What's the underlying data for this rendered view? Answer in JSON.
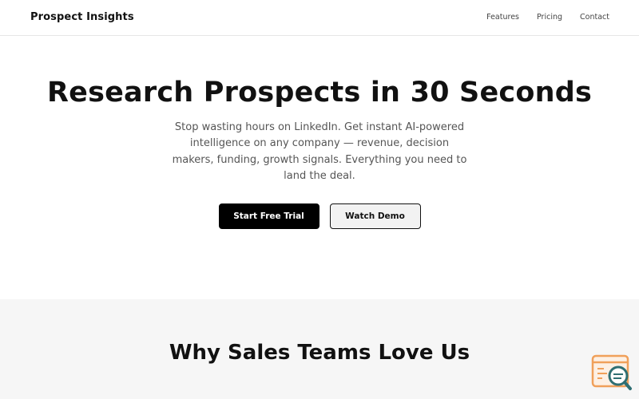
{
  "header": {
    "brand": "Prospect Insights",
    "nav": [
      "Features",
      "Pricing",
      "Contact"
    ]
  },
  "hero": {
    "title": "Research Prospects in 30 Seconds",
    "subtitle": "Stop wasting hours on LinkedIn. Get instant AI-powered intelligence on any company — revenue, decision makers, funding, growth signals. Everything you need to land the deal.",
    "primary_cta": "Start Free Trial",
    "secondary_cta": "Watch Demo"
  },
  "features": {
    "title": "Why Sales Teams Love Us"
  },
  "widget": {
    "icon": "search-document-icon",
    "colors": {
      "orange": "#f0a05a",
      "teal": "#2f6f73"
    }
  },
  "colors": {
    "primary_button": "#000000",
    "secondary_button": "#f2f2f2",
    "section_background": "#f6f6f6",
    "body_text": "#555555"
  }
}
